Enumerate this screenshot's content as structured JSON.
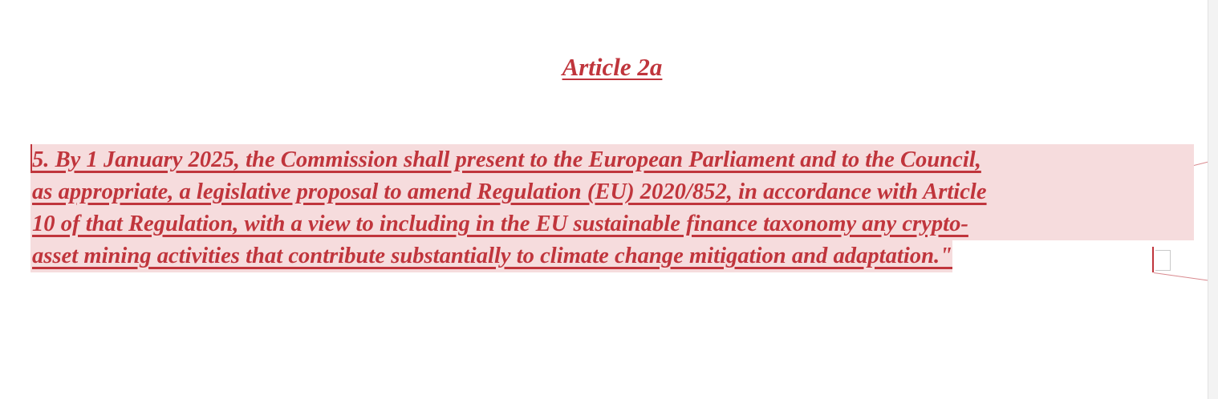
{
  "document": {
    "heading": "Article 2a",
    "paragraph_lines": [
      "5. By 1 January 2025, the Commission shall present to the European Parliament and to the Council,",
      "as appropriate, a legislative proposal to amend Regulation (EU) 2020/852, in accordance with Article",
      "10 of that Regulation, with a view to including in the EU sustainable finance taxonomy any crypto-",
      "asset mining activities that contribute substantially to climate change mitigation and adaptation.\""
    ]
  },
  "colors": {
    "tracked_change_text": "#c0353c",
    "highlight": "#f6dcdd"
  }
}
